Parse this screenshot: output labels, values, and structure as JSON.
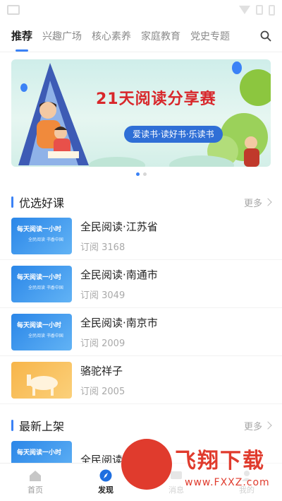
{
  "tabs": [
    "推荐",
    "兴趣广场",
    "核心素养",
    "家庭教育",
    "党史专题"
  ],
  "banner": {
    "title": "21天阅读分享赛",
    "subtitle": "爱读书·读好书·乐读书"
  },
  "sections": {
    "featured": {
      "title": "优选好课",
      "more": "更多"
    },
    "latest": {
      "title": "最新上架",
      "more": "更多"
    }
  },
  "courses": [
    {
      "title": "全民阅读·江苏省",
      "sub": "订阅 3168",
      "thumb_title": "每天阅读一小时",
      "thumb_sub": "全民阅读 书香中国"
    },
    {
      "title": "全民阅读·南通市",
      "sub": "订阅 3049",
      "thumb_title": "每天阅读一小时",
      "thumb_sub": "全民阅读 书香中国"
    },
    {
      "title": "全民阅读·南京市",
      "sub": "订阅 2009",
      "thumb_title": "每天阅读一小时",
      "thumb_sub": "全民阅读 书香中国"
    },
    {
      "title": "骆驼祥子",
      "sub": "订阅 2005"
    }
  ],
  "latest_courses": [
    {
      "title": "全民阅读·江苏省",
      "thumb_title": "每天阅读一小时"
    }
  ],
  "bottom_nav": [
    "首页",
    "发现",
    "消息",
    "我的"
  ],
  "watermark": {
    "text": "飞翔下载",
    "url": "www.FXXZ.com"
  },
  "colors": {
    "accent": "#3b82f6",
    "banner_title": "#d8272b",
    "watermark": "#e03b2d"
  }
}
